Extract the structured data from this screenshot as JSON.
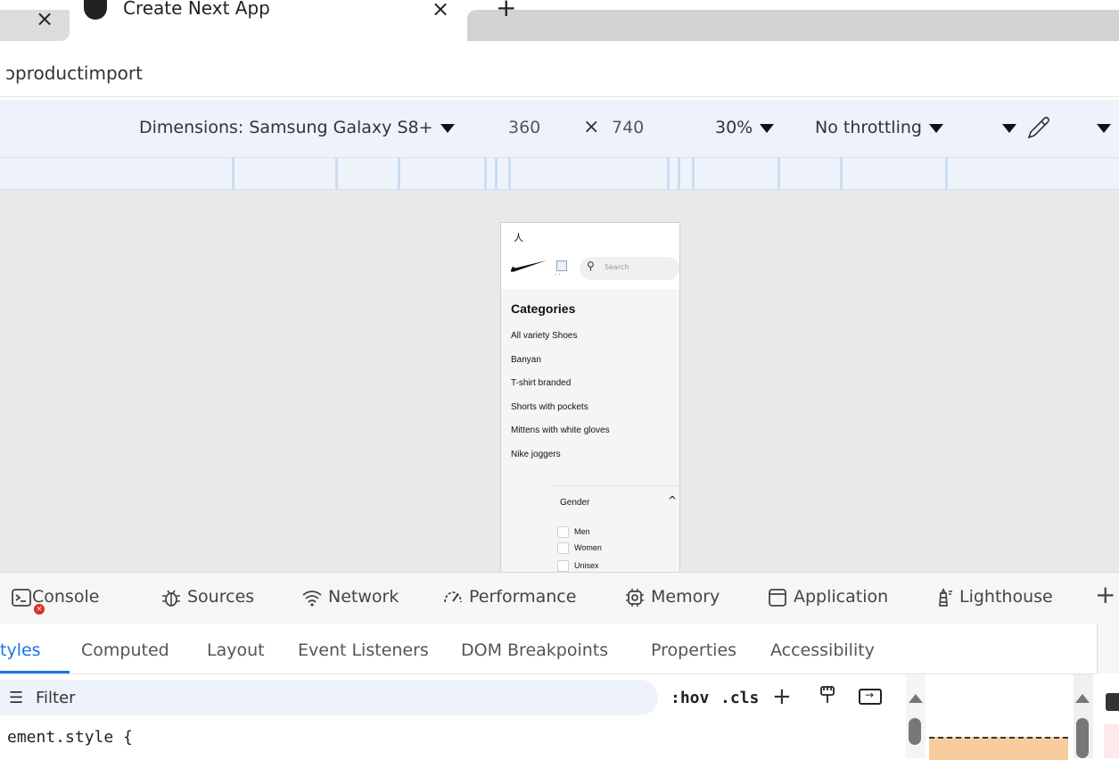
{
  "browser": {
    "prev_tab_close": "×",
    "active_tab": {
      "title": "Create Next App",
      "close": "×"
    },
    "new_tab": "+",
    "address": "productimport"
  },
  "device_toolbar": {
    "dimensions_label": "Dimensions: Samsung Galaxy S8+",
    "width": "360",
    "times": "×",
    "height": "740",
    "zoom": "30%",
    "throttling": "No throttling"
  },
  "page": {
    "search_placeholder": "Search",
    "categories_title": "Categories",
    "categories": [
      "All variety Shoes",
      "Banyan",
      "T-shirt branded",
      "Shorts with pockets",
      "Mittens with white gloves",
      "Nike joggers"
    ],
    "gender": {
      "title": "Gender",
      "options": [
        "Men",
        "Women",
        "Unisex"
      ]
    }
  },
  "devtools": {
    "tabs": [
      "Console",
      "Sources",
      "Network",
      "Performance",
      "Memory",
      "Application",
      "Lighthouse"
    ],
    "sub_tabs": [
      "Styles",
      "Computed",
      "Layout",
      "Event Listeners",
      "DOM Breakpoints",
      "Properties",
      "Accessibility"
    ],
    "active_sub_tab_visible": "tyles",
    "filter_placeholder": "Filter",
    "hov": ":hov",
    "cls": ".cls",
    "element_style": "ement.style {",
    "error_count_icon": "×"
  },
  "colors": {
    "accent": "#1a73e8",
    "toolbar_bg": "#eef3fb",
    "error": "#d93025",
    "box_model_margin": "#f9cc9d"
  }
}
